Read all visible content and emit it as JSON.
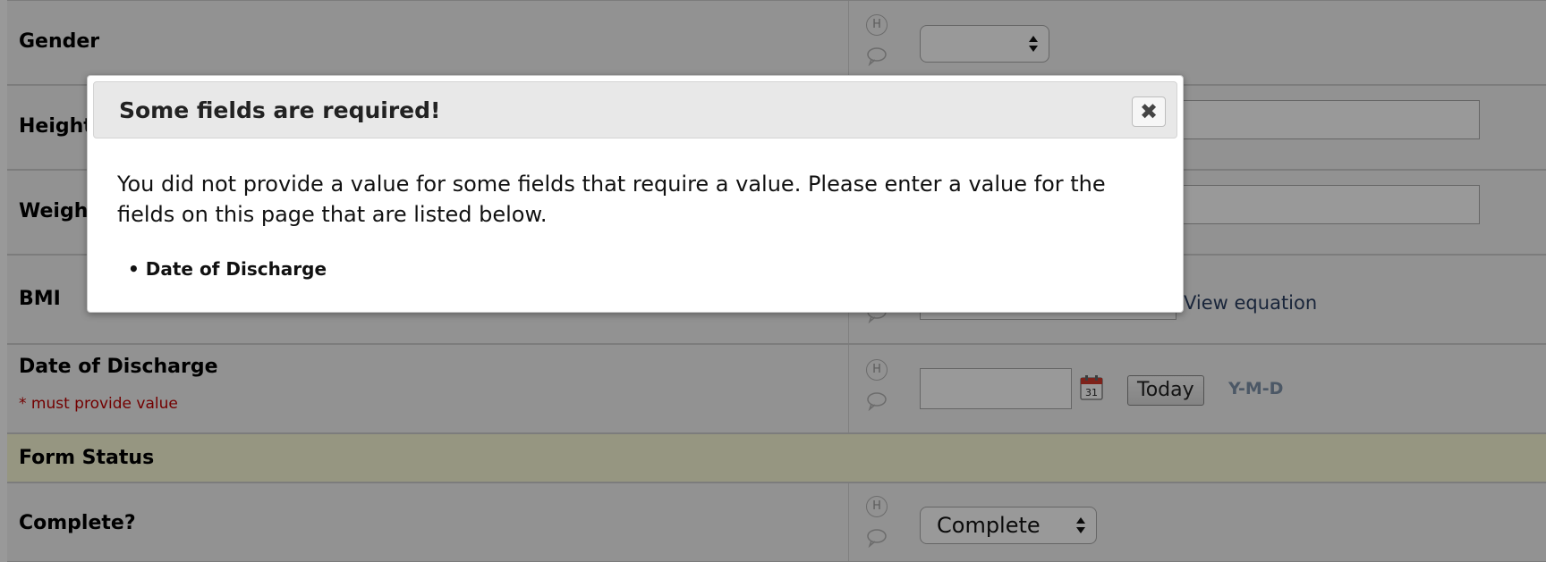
{
  "fields": {
    "gender": {
      "label": "Gender",
      "value": ""
    },
    "height": {
      "label": "Height"
    },
    "weight": {
      "label": "Weight"
    },
    "bmi": {
      "label": "BMI",
      "link": "View equation"
    },
    "discharge": {
      "label": "Date of Discharge",
      "required_note": "* must provide value",
      "today_label": "Today",
      "format_hint": "Y-M-D"
    }
  },
  "section": {
    "title": "Form Status"
  },
  "complete": {
    "label": "Complete?",
    "value": "Complete"
  },
  "icons": {
    "history": "H",
    "comment": "comment-icon",
    "calendar": "calendar-icon"
  },
  "calendar": {
    "day": "31"
  },
  "dialog": {
    "title": "Some fields are required!",
    "close": "✖",
    "message": "You did not provide a value for some fields that require a value. Please enter a value for the fields on this page that are listed below.",
    "items": [
      "Date of Discharge"
    ],
    "bullet": "•"
  },
  "colors": {
    "overlay": "rgba(0,0,0,0.40)",
    "required": "#c00000",
    "section_bg": "#fafad8"
  }
}
